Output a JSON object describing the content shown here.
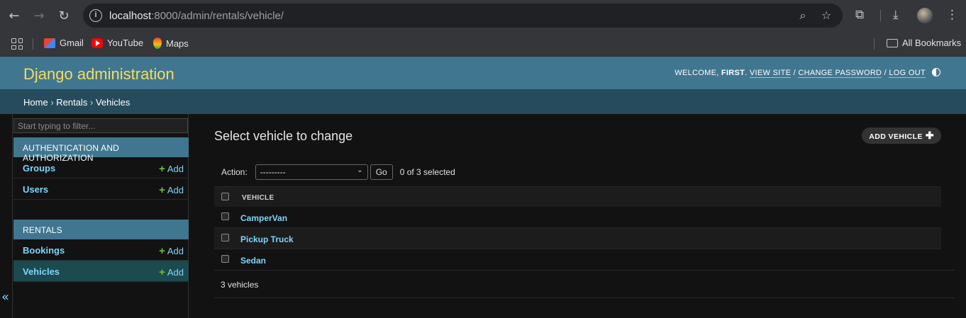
{
  "browser": {
    "url_host": "localhost",
    "url_rest": ":8000/admin/rentals/vehicle/",
    "bookmarks": [
      {
        "label": "Gmail"
      },
      {
        "label": "YouTube"
      },
      {
        "label": "Maps"
      }
    ],
    "all_bookmarks": "All Bookmarks"
  },
  "header": {
    "brand": "Django administration",
    "welcome": "WELCOME,",
    "user": "FIRST",
    "view_site": "VIEW SITE",
    "change_password": "CHANGE PASSWORD",
    "log_out": "LOG OUT"
  },
  "breadcrumbs": {
    "home": "Home",
    "app": "Rentals",
    "current": "Vehicles",
    "sep": "›"
  },
  "sidebar": {
    "filter_placeholder": "Start typing to filter...",
    "modules": [
      {
        "caption": "AUTHENTICATION AND AUTHORIZATION",
        "models": [
          {
            "name": "Groups",
            "add": "Add"
          },
          {
            "name": "Users",
            "add": "Add"
          }
        ]
      },
      {
        "caption": "RENTALS",
        "models": [
          {
            "name": "Bookings",
            "add": "Add"
          },
          {
            "name": "Vehicles",
            "add": "Add"
          }
        ]
      }
    ],
    "collapse": "«"
  },
  "content": {
    "title": "Select vehicle to change",
    "add_button": "ADD VEHICLE",
    "action_label": "Action:",
    "action_selected": "---------",
    "go": "Go",
    "counter": "0 of 3 selected",
    "column": "VEHICLE",
    "rows": [
      "CamperVan",
      "Pickup Truck",
      "Sedan"
    ],
    "paginator": "3 vehicles"
  },
  "colors": {
    "header_bg": "#417690",
    "brand": "#f5dd5d",
    "breadcrumb_bg": "#264b5d",
    "link": "#81d4fa",
    "add_plus": "#70bf2b"
  }
}
